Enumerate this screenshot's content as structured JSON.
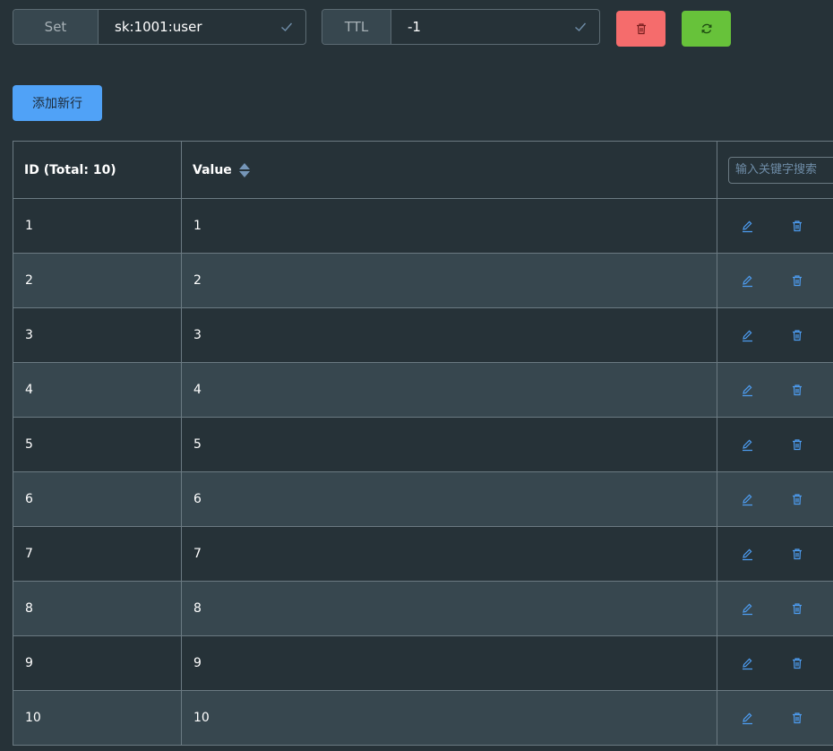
{
  "toolbar": {
    "type_label": "Set",
    "key_value": "sk:1001:user",
    "ttl_label": "TTL",
    "ttl_value": "-1"
  },
  "add_button_label": "添加新行",
  "table": {
    "headers": {
      "id": "ID (Total: 10)",
      "value": "Value",
      "search_placeholder": "输入关键字搜索"
    },
    "rows": [
      {
        "id": "1",
        "value": "1"
      },
      {
        "id": "2",
        "value": "2"
      },
      {
        "id": "3",
        "value": "3"
      },
      {
        "id": "4",
        "value": "4"
      },
      {
        "id": "5",
        "value": "5"
      },
      {
        "id": "6",
        "value": "6"
      },
      {
        "id": "7",
        "value": "7"
      },
      {
        "id": "8",
        "value": "8"
      },
      {
        "id": "9",
        "value": "9"
      },
      {
        "id": "10",
        "value": "10"
      }
    ]
  },
  "colors": {
    "background": "#263238",
    "row_alt": "#37474f",
    "primary": "#50a2f7",
    "danger": "#f56c6c",
    "success": "#67c23a",
    "icon_blue": "#4d9cf0"
  }
}
